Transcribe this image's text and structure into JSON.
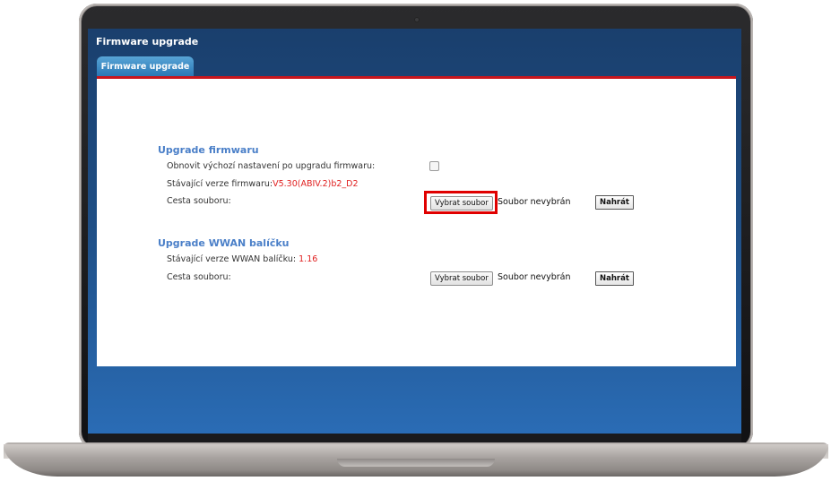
{
  "header": {
    "title": "Firmware upgrade"
  },
  "tabs": [
    {
      "label": "Firmware upgrade"
    }
  ],
  "firmware": {
    "section_title": "Upgrade firmwaru",
    "reset_label": "Obnovit výchozí nastavení po upgradu firmwaru:",
    "current_version_label": "Stávající verze firmwaru:",
    "current_version_value": "V5.30(ABIV.2)b2_D2",
    "file_path_label": "Cesta souboru:",
    "choose_file_label": "Vybrat soubor",
    "no_file_text": "Soubor nevybrán",
    "upload_label": "Nahrát"
  },
  "wwan": {
    "section_title": "Upgrade WWAN balíčku",
    "current_version_label": "Stávající verze WWAN balíčku:",
    "current_version_value": "1.16",
    "file_path_label": "Cesta souboru:",
    "choose_file_label": "Vybrat soubor",
    "no_file_text": "Soubor nevybrán",
    "upload_label": "Nahrát"
  },
  "colors": {
    "highlight": "#e00000",
    "accent_line": "#c8161d",
    "section_title": "#4a7fc8",
    "value_text": "#e02020"
  }
}
